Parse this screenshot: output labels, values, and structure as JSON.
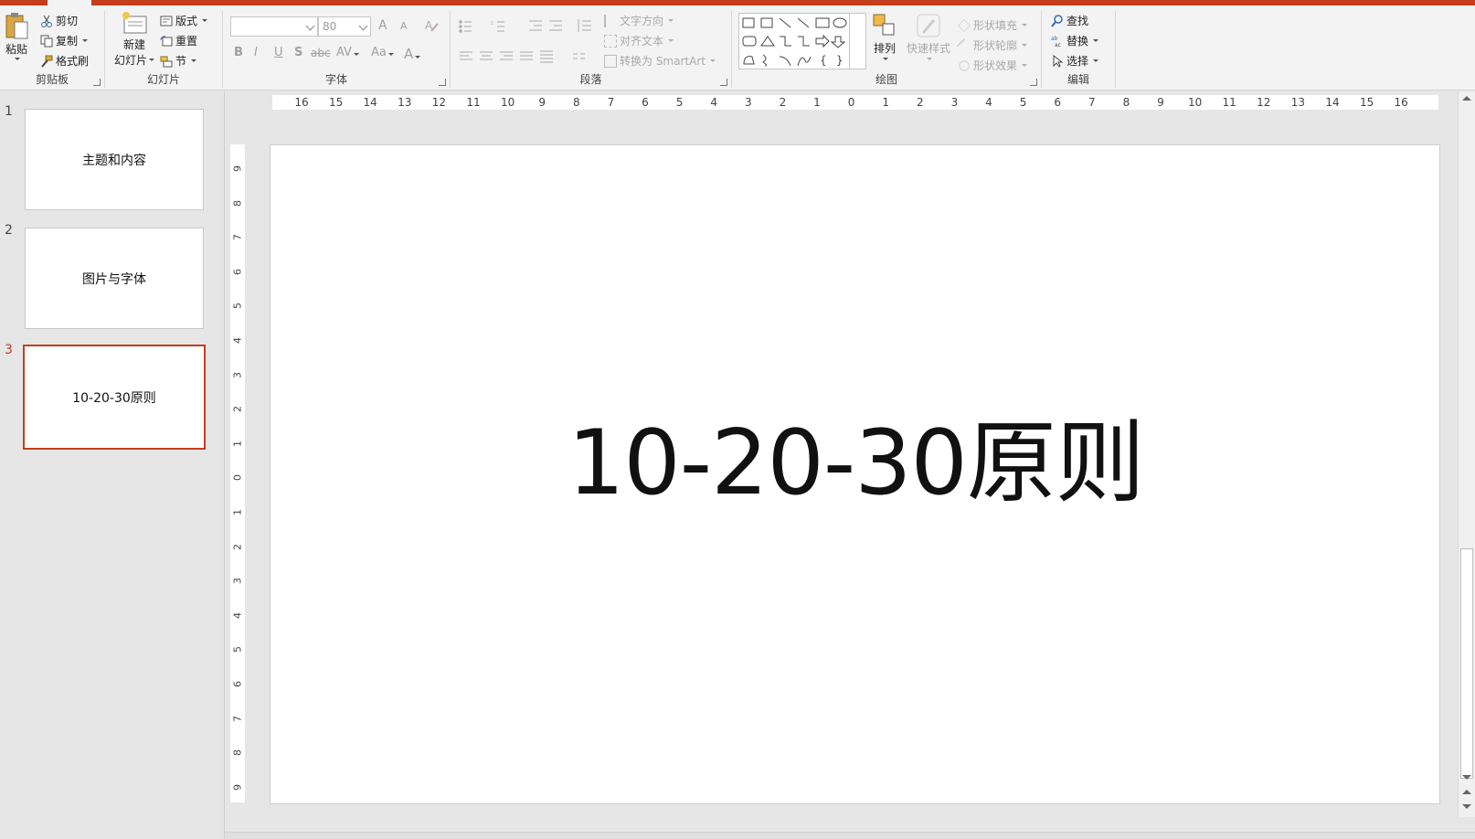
{
  "ribbon": {
    "clipboard": {
      "label": "剪贴板",
      "paste": "粘贴",
      "cut": "剪切",
      "copy": "复制",
      "format_painter": "格式刷"
    },
    "slides": {
      "label": "幻灯片",
      "new_slide_line1": "新建",
      "new_slide_line2": "幻灯片",
      "layout": "版式",
      "reset": "重置",
      "section": "节"
    },
    "font": {
      "label": "字体",
      "font_name": "",
      "font_size": "80",
      "grow": "A",
      "shrink": "A",
      "bold": "B",
      "italic": "I",
      "underline": "U",
      "shadow": "S",
      "strike": "abc",
      "spacing": "AV",
      "case": "Aa",
      "color": "A"
    },
    "paragraph": {
      "label": "段落",
      "text_direction": "文字方向",
      "align_text": "对齐文本",
      "smartart": "转换为 SmartArt"
    },
    "drawing": {
      "label": "绘图",
      "arrange": "排列",
      "quick_styles": "快速样式",
      "shape_fill": "形状填充",
      "shape_outline": "形状轮廓",
      "shape_effects": "形状效果"
    },
    "editing": {
      "label": "编辑",
      "find": "查找",
      "replace": "替换",
      "select": "选择"
    }
  },
  "slides": [
    {
      "number": "1",
      "title": "主题和内容"
    },
    {
      "number": "2",
      "title": "图片与字体"
    },
    {
      "number": "3",
      "title": "10-20-30原则"
    }
  ],
  "active_slide": 3,
  "current_slide": {
    "title": "10-20-30原则"
  },
  "hruler": [
    "16",
    "15",
    "14",
    "13",
    "12",
    "11",
    "10",
    "9",
    "8",
    "7",
    "6",
    "5",
    "4",
    "3",
    "2",
    "1",
    "0",
    "1",
    "2",
    "3",
    "4",
    "5",
    "6",
    "7",
    "8",
    "9",
    "10",
    "11",
    "12",
    "13",
    "14",
    "15",
    "16"
  ],
  "vruler": [
    "9",
    "8",
    "7",
    "6",
    "5",
    "4",
    "3",
    "2",
    "1",
    "0",
    "1",
    "2",
    "3",
    "4",
    "5",
    "6",
    "7",
    "8",
    "9"
  ],
  "colors": {
    "accent": "#c43e1c"
  }
}
